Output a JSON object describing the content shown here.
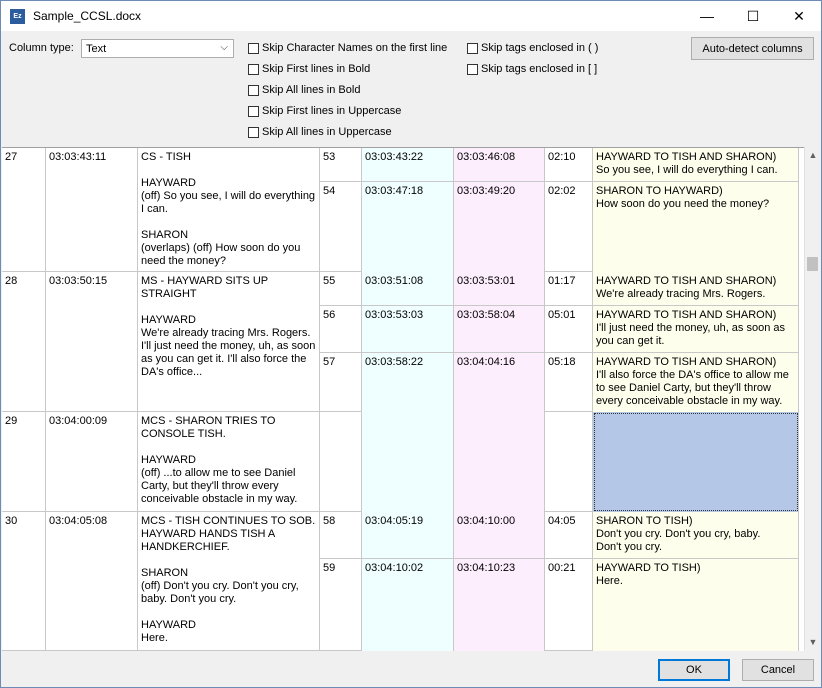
{
  "window": {
    "title": "Sample_CCSL.docx",
    "icon_text": "Ez"
  },
  "titlebar_buttons": {
    "minimize": "—",
    "maximize": "☐",
    "close": "✕"
  },
  "options": {
    "column_type_label": "Column type:",
    "column_type_value": "Text",
    "checkboxes": [
      "Skip Character Names on the first line",
      "Skip First lines in Bold",
      "Skip All lines in Bold",
      "Skip First lines in Uppercase",
      "Skip All lines in Uppercase"
    ],
    "checkboxes_right": [
      "Skip tags enclosed in ( )",
      "Skip tags enclosed in [ ]"
    ],
    "autodetect_label": "Auto-detect columns"
  },
  "colors": {
    "in_col": "#effefe",
    "out_col": "#fdeefd",
    "text_col": "#fefeec",
    "selected": "#b4c7e7"
  },
  "rows": [
    {
      "num": "27",
      "tc": "03:03:43:11",
      "desc": "CS - TISH\n\nHAYWARD\n(off) So you see, I will do everything I can.\n\nSHARON\n(overlaps) (off) How soon do you need the money?",
      "subs": [
        {
          "n": "53",
          "in": "03:03:43:22",
          "out": "03:03:46:08",
          "dur": "02:10",
          "text": "HAYWARD TO TISH AND SHARON)\nSo you see, I will do everything I can."
        },
        {
          "n": "54",
          "in": "03:03:47:18",
          "out": "03:03:49:20",
          "dur": "02:02",
          "text": "SHARON TO HAYWARD)\nHow soon do you need the money?"
        }
      ]
    },
    {
      "num": "28",
      "tc": "03:03:50:15",
      "desc": "MS - HAYWARD SITS UP STRAIGHT\n\nHAYWARD\nWe're already tracing Mrs. Rogers. I'll just need the money, uh, as soon as you can get it. I'll also force the DA's office...",
      "subs": [
        {
          "n": "55",
          "in": "03:03:51:08",
          "out": "03:03:53:01",
          "dur": "01:17",
          "text": "HAYWARD TO TISH AND SHARON)\nWe're already tracing Mrs. Rogers."
        },
        {
          "n": "56",
          "in": "03:03:53:03",
          "out": "03:03:58:04",
          "dur": "05:01",
          "text": "HAYWARD TO TISH AND SHARON)\nI'll just need the money, uh, as soon as you can get it."
        },
        {
          "n": "57",
          "in": "03:03:58:22",
          "out": "03:04:04:16",
          "dur": "05:18",
          "text": "HAYWARD TO TISH AND SHARON)\nI'll also force the DA's office to allow me to see Daniel Carty, but they'll throw every conceivable obstacle in my way."
        }
      ]
    },
    {
      "num": "29",
      "tc": "03:04:00:09",
      "desc": "MCS - SHARON TRIES TO CONSOLE TISH.\n\nHAYWARD\n(off) ...to allow me to see Daniel Carty, but they'll throw every conceivable obstacle in my way.",
      "subs": [
        {
          "n": "",
          "in": "",
          "out": "",
          "dur": "",
          "text": ""
        }
      ]
    },
    {
      "num": "30",
      "tc": "03:04:05:08",
      "desc": "MCS - TISH CONTINUES TO SOB. HAYWARD HANDS TISH A HANDKERCHIEF.\n\nSHARON\n(off) Don't you cry. Don't you cry, baby. Don't you cry.\n\nHAYWARD\nHere.",
      "subs": [
        {
          "n": "58",
          "in": "03:04:05:19",
          "out": "03:04:10:00",
          "dur": "04:05",
          "text": "SHARON TO TISH)\nDon't you cry. Don't you cry, baby.\nDon't you cry."
        },
        {
          "n": "59",
          "in": "03:04:10:02",
          "out": "03:04:10:23",
          "dur": "00:21",
          "text": "HAYWARD TO TISH)\nHere."
        }
      ]
    }
  ],
  "buttons": {
    "ok": "OK",
    "cancel": "Cancel"
  },
  "scrollbar": {
    "up": "▲",
    "down": "▼"
  }
}
